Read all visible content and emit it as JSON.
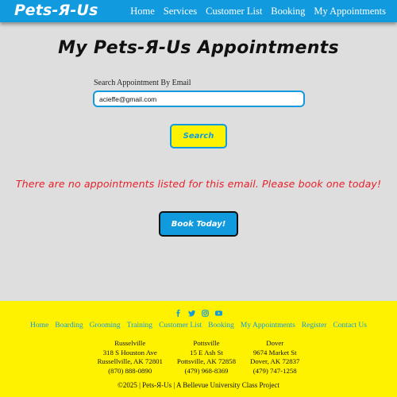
{
  "navbar": {
    "brand": "Pets-Я-Us",
    "links": [
      "Home",
      "Services",
      "Customer List",
      "Booking",
      "My Appointments"
    ],
    "background": "#119bde"
  },
  "main": {
    "title": "My Pets-Я-Us Appointments",
    "search": {
      "label": "Search Appointment By Email",
      "value": "acieffe@gmail.com",
      "button_label": "Search"
    },
    "message": "There are no appointments listed for this email. Please book one today!",
    "book_button_label": "Book Today!"
  },
  "footer": {
    "background": "#fff200",
    "social_icons": [
      "facebook-icon",
      "twitter-icon",
      "instagram-icon",
      "youtube-icon"
    ],
    "links": [
      "Home",
      "Boarding",
      "Grooming",
      "Training",
      "Customer List",
      "Booking",
      "My Appointments",
      "Register",
      "Contact Us"
    ],
    "locations": [
      {
        "city": "Russelville",
        "street": "318 S Houston Ave",
        "region": "Russellville, AK 72801",
        "phone": "(870) 888-0890"
      },
      {
        "city": "Pottsville",
        "street": "15 E Ash St",
        "region": "Pottsville, AK 72858",
        "phone": "(479) 968-8369"
      },
      {
        "city": "Dover",
        "street": "9674 Market St",
        "region": "Dover, AK 72837",
        "phone": "(479) 747-1258"
      }
    ],
    "copyright": "©2025 | Pets-Я-Us | A Bellevue University Class Project"
  }
}
